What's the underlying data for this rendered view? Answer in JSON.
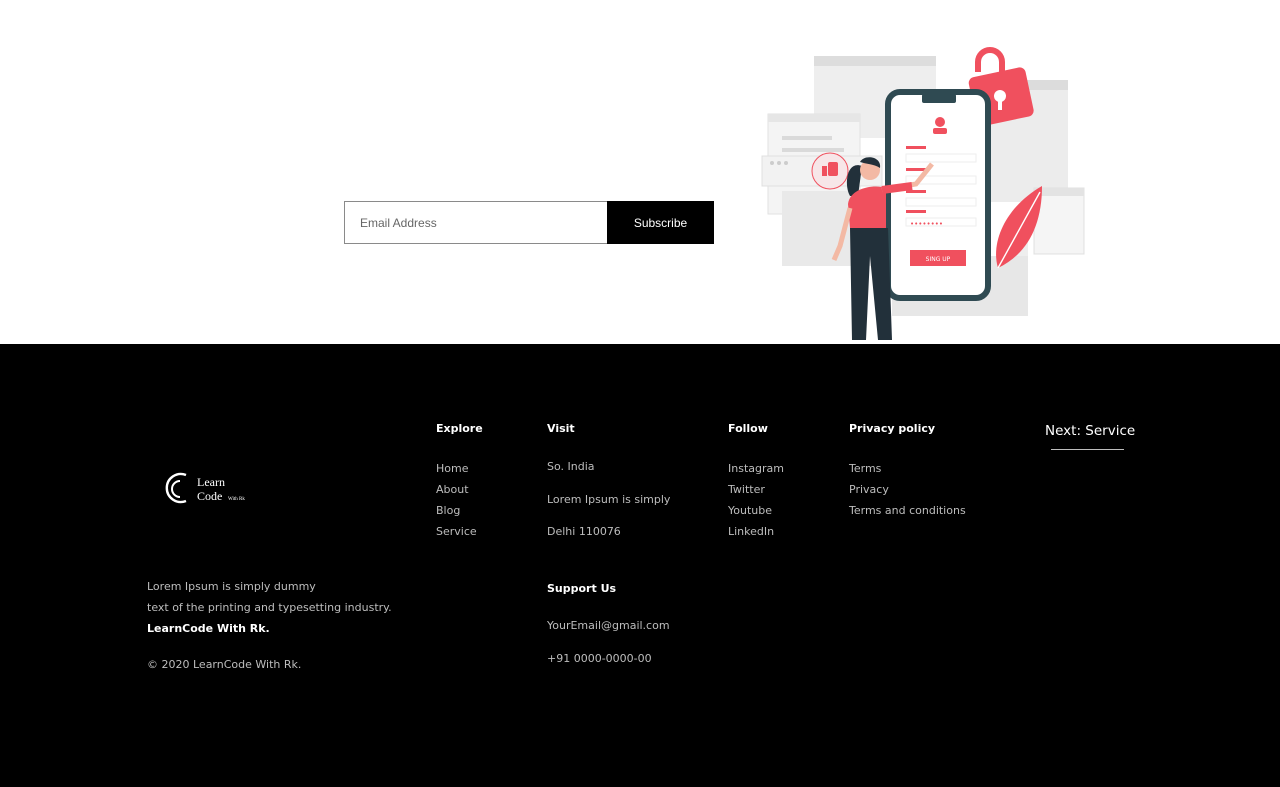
{
  "subscribe": {
    "email_placeholder": "Email Address",
    "button_label": "Subscribe"
  },
  "illustration": {
    "signup_button_label": "SING UP"
  },
  "footer": {
    "logo": {
      "alt": "LearnCode With Rk",
      "word1": "Learn",
      "word2": "Code",
      "word3": "With Rk"
    },
    "about": {
      "line1": "Lorem Ipsum is simply dummy",
      "line2": "text of the printing and typesetting industry.",
      "brand": "LearnCode With Rk.",
      "copyright": "© 2020 LearnCode With Rk."
    },
    "explore": {
      "heading": "Explore",
      "items": [
        "Home",
        "About",
        "Blog",
        "Service"
      ]
    },
    "visit": {
      "heading": "Visit",
      "lines": [
        "So. India",
        "Lorem Ipsum is simply",
        "Delhi 110076"
      ]
    },
    "support": {
      "heading": "Support Us",
      "email": "YourEmail@gmail.com",
      "phone": "+91 0000-0000-00"
    },
    "follow": {
      "heading": "Follow",
      "items": [
        "Instagram",
        "Twitter",
        "Youtube",
        "LinkedIn"
      ]
    },
    "privacy": {
      "heading": "Privacy policy",
      "items": [
        "Terms",
        "Privacy",
        "Terms and conditions"
      ]
    },
    "next": {
      "label": "Next: Service"
    }
  },
  "colors": {
    "accent": "#f0505e",
    "phone_frame": "#2f4a52",
    "footer_bg": "#000000"
  }
}
